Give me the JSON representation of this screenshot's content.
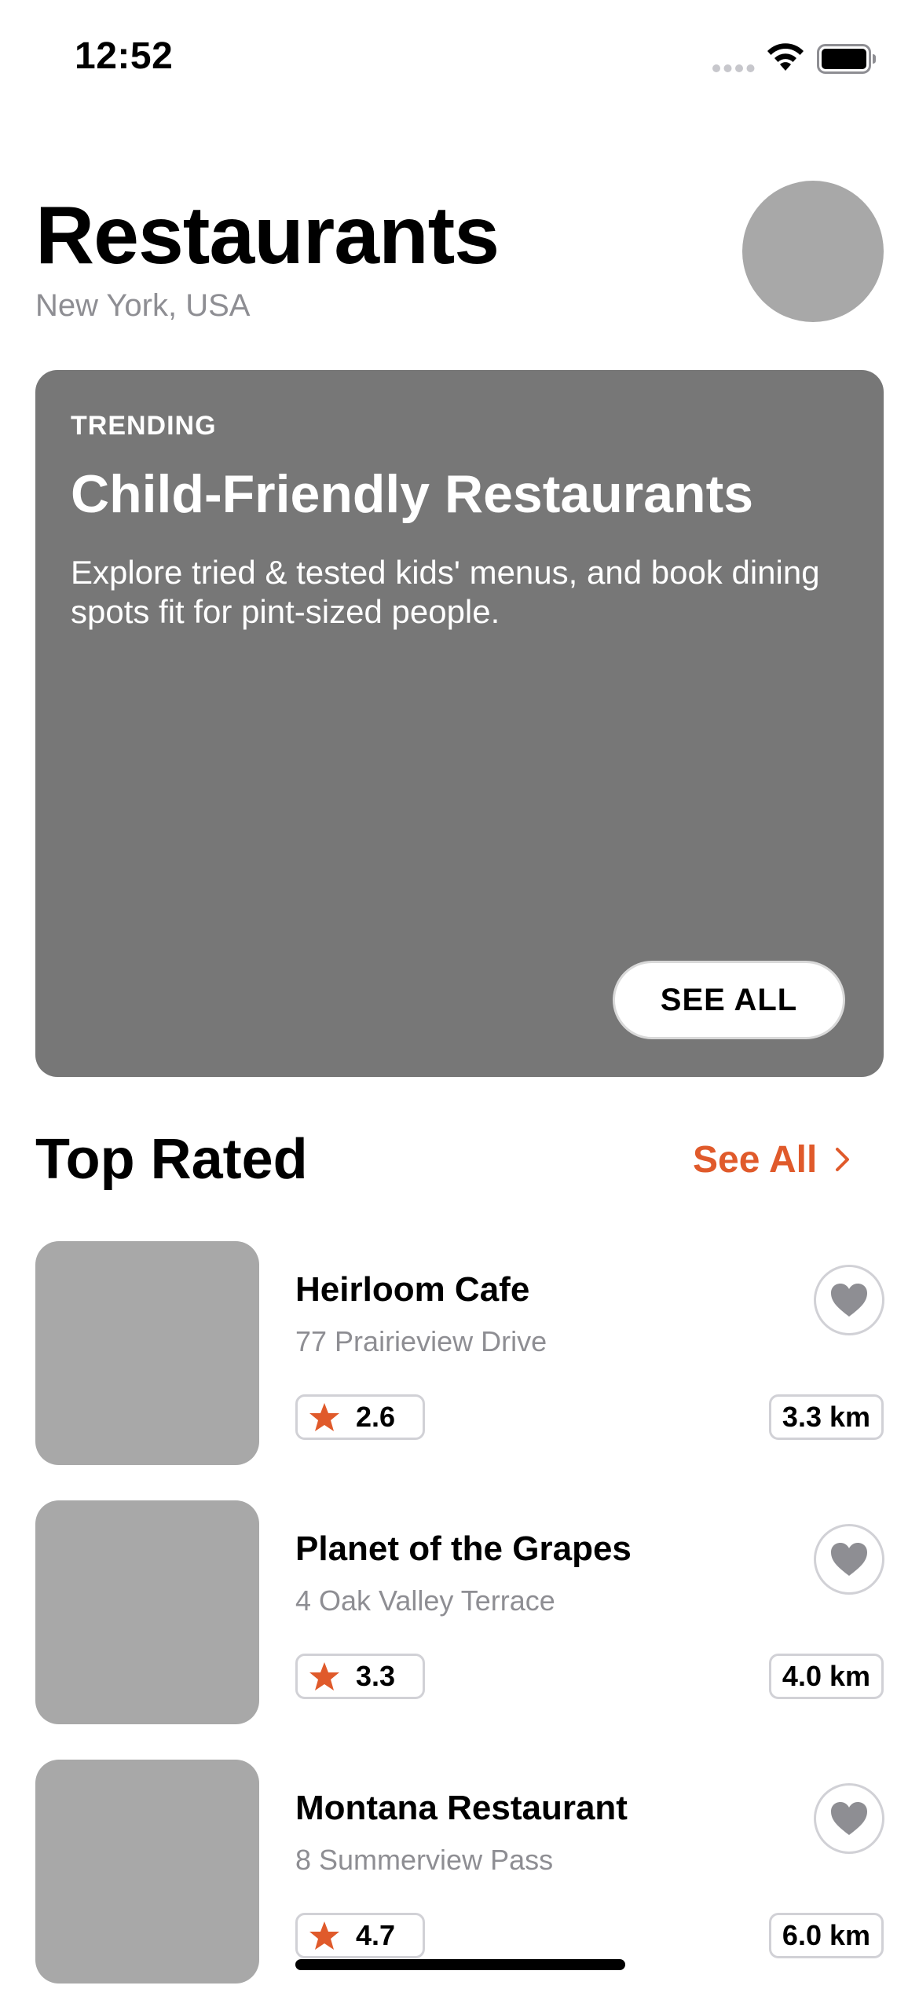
{
  "status_bar": {
    "time": "12:52"
  },
  "header": {
    "title": "Restaurants",
    "subtitle": "New York, USA"
  },
  "trending": {
    "label": "TRENDING",
    "title": "Child-Friendly Restaurants",
    "description": "Explore tried & tested kids' menus, and book dining spots fit for pint-sized people.",
    "button_label": "SEE ALL"
  },
  "top_rated": {
    "title": "Top Rated",
    "see_all_label": "See All",
    "items": [
      {
        "name": "Heirloom Cafe",
        "address": "77 Prairieview Drive",
        "rating": "2.6",
        "distance": "3.3 km"
      },
      {
        "name": "Planet of the Grapes",
        "address": "4 Oak Valley Terrace",
        "rating": "3.3",
        "distance": "4.0 km"
      },
      {
        "name": "Montana Restaurant",
        "address": "8 Summerview Pass",
        "rating": "4.7",
        "distance": "6.0 km"
      }
    ]
  },
  "colors": {
    "accent": "#e05a2b",
    "card_background": "#777777",
    "placeholder": "#a8a8a8",
    "secondary_text": "#8e8e93",
    "heart_icon": "#8e8e93"
  },
  "icons": {
    "rating": "star-icon",
    "favorite": "heart-icon",
    "see_all": "chevron-right-icon"
  }
}
